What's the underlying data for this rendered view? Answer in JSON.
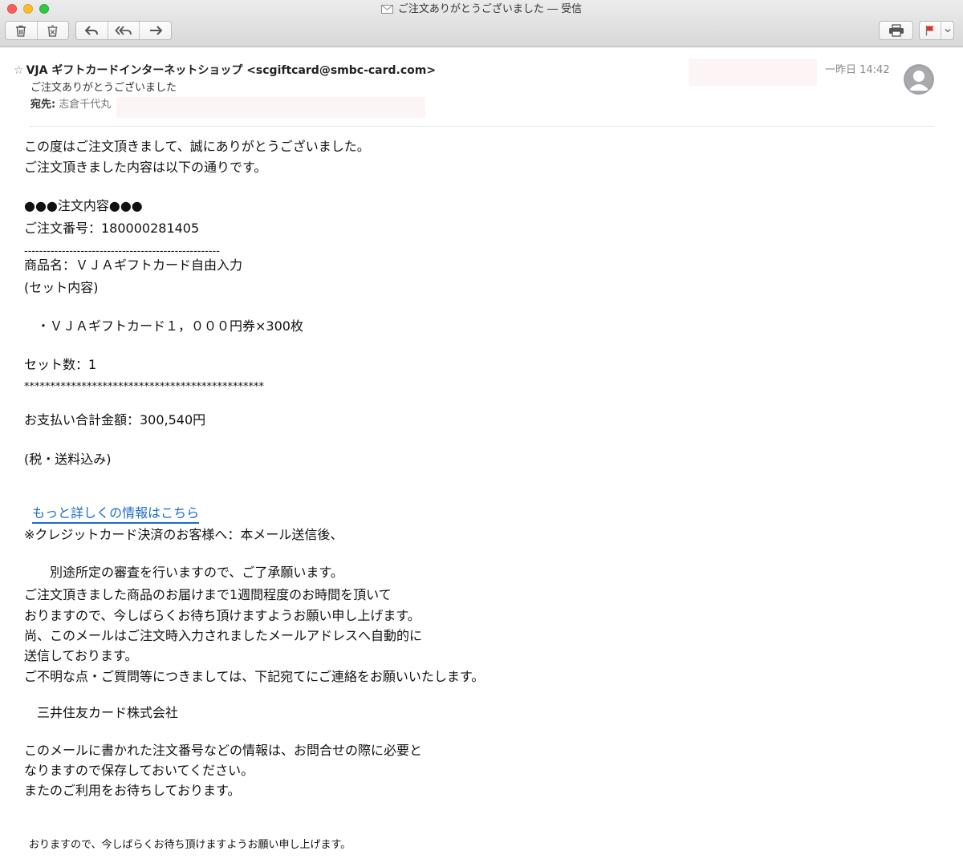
{
  "window": {
    "title": "ご注文ありがとうございました ― 受信"
  },
  "toolbar": {
    "delete_icon": "trash-icon",
    "junk_icon": "junk-icon",
    "reply_icon": "reply-icon",
    "reply_all_icon": "reply-all-icon",
    "forward_icon": "forward-icon",
    "print_icon": "printer-icon",
    "flag_icon": "flag-icon",
    "flag_color": "#e0302a"
  },
  "header": {
    "from": "VJA ギフトカードインターネットショップ <scgiftcard@smbc-card.com>",
    "subject": "ご注文ありがとうございました",
    "to_label": "宛先:",
    "to_name": "志倉千代丸",
    "date": "一昨日 14:42"
  },
  "body": {
    "l1": "この度はご注文頂きまして、誠にありがとうございました。",
    "l2": "ご注文頂きました内容は以下の通りです。",
    "l3": "●●●注文内容●●●",
    "l4": "ご注文番号：180000281405",
    "l5": "----------------------------------------------------",
    "l6": "商品名：ＶＪＡギフトカード自由入力",
    "l7": "(セット内容)",
    "l8": "　・ＶＪＡギフトカード１，０００円券×300枚",
    "l9": "セット数：1",
    "l10": "**********************************************",
    "l11": "お支払い合計金額：300,540円",
    "l12": "(税・送料込み)",
    "link": "もっと詳しくの情報はこちら",
    "l13": "※クレジットカード決済のお客様へ：本メール送信後、",
    "l14": "　　別途所定の審査を行いますので、ご了承願います。",
    "l15": "ご注文頂きました商品のお届けまで1週間程度のお時間を頂いて",
    "l16": "おりますので、今しばらくお待ち頂けますようお願い申し上げます。",
    "l17": "尚、このメールはご注文時入力されましたメールアドレスへ自動的に",
    "l18": "送信しております。",
    "l19": "ご不明な点・ご質問等につきましては、下記宛てにご連絡をお願いいたします。",
    "l20": "　三井住友カード株式会社",
    "l21": "このメールに書かれた注文番号などの情報は、お問合せの際に必要と",
    "l22": "なりますので保存しておいてください。",
    "l23": "またのご利用をお待ちしております。",
    "l24": "おりますので、今しばらくお待ち頂けますようお願い申し上げます。"
  }
}
